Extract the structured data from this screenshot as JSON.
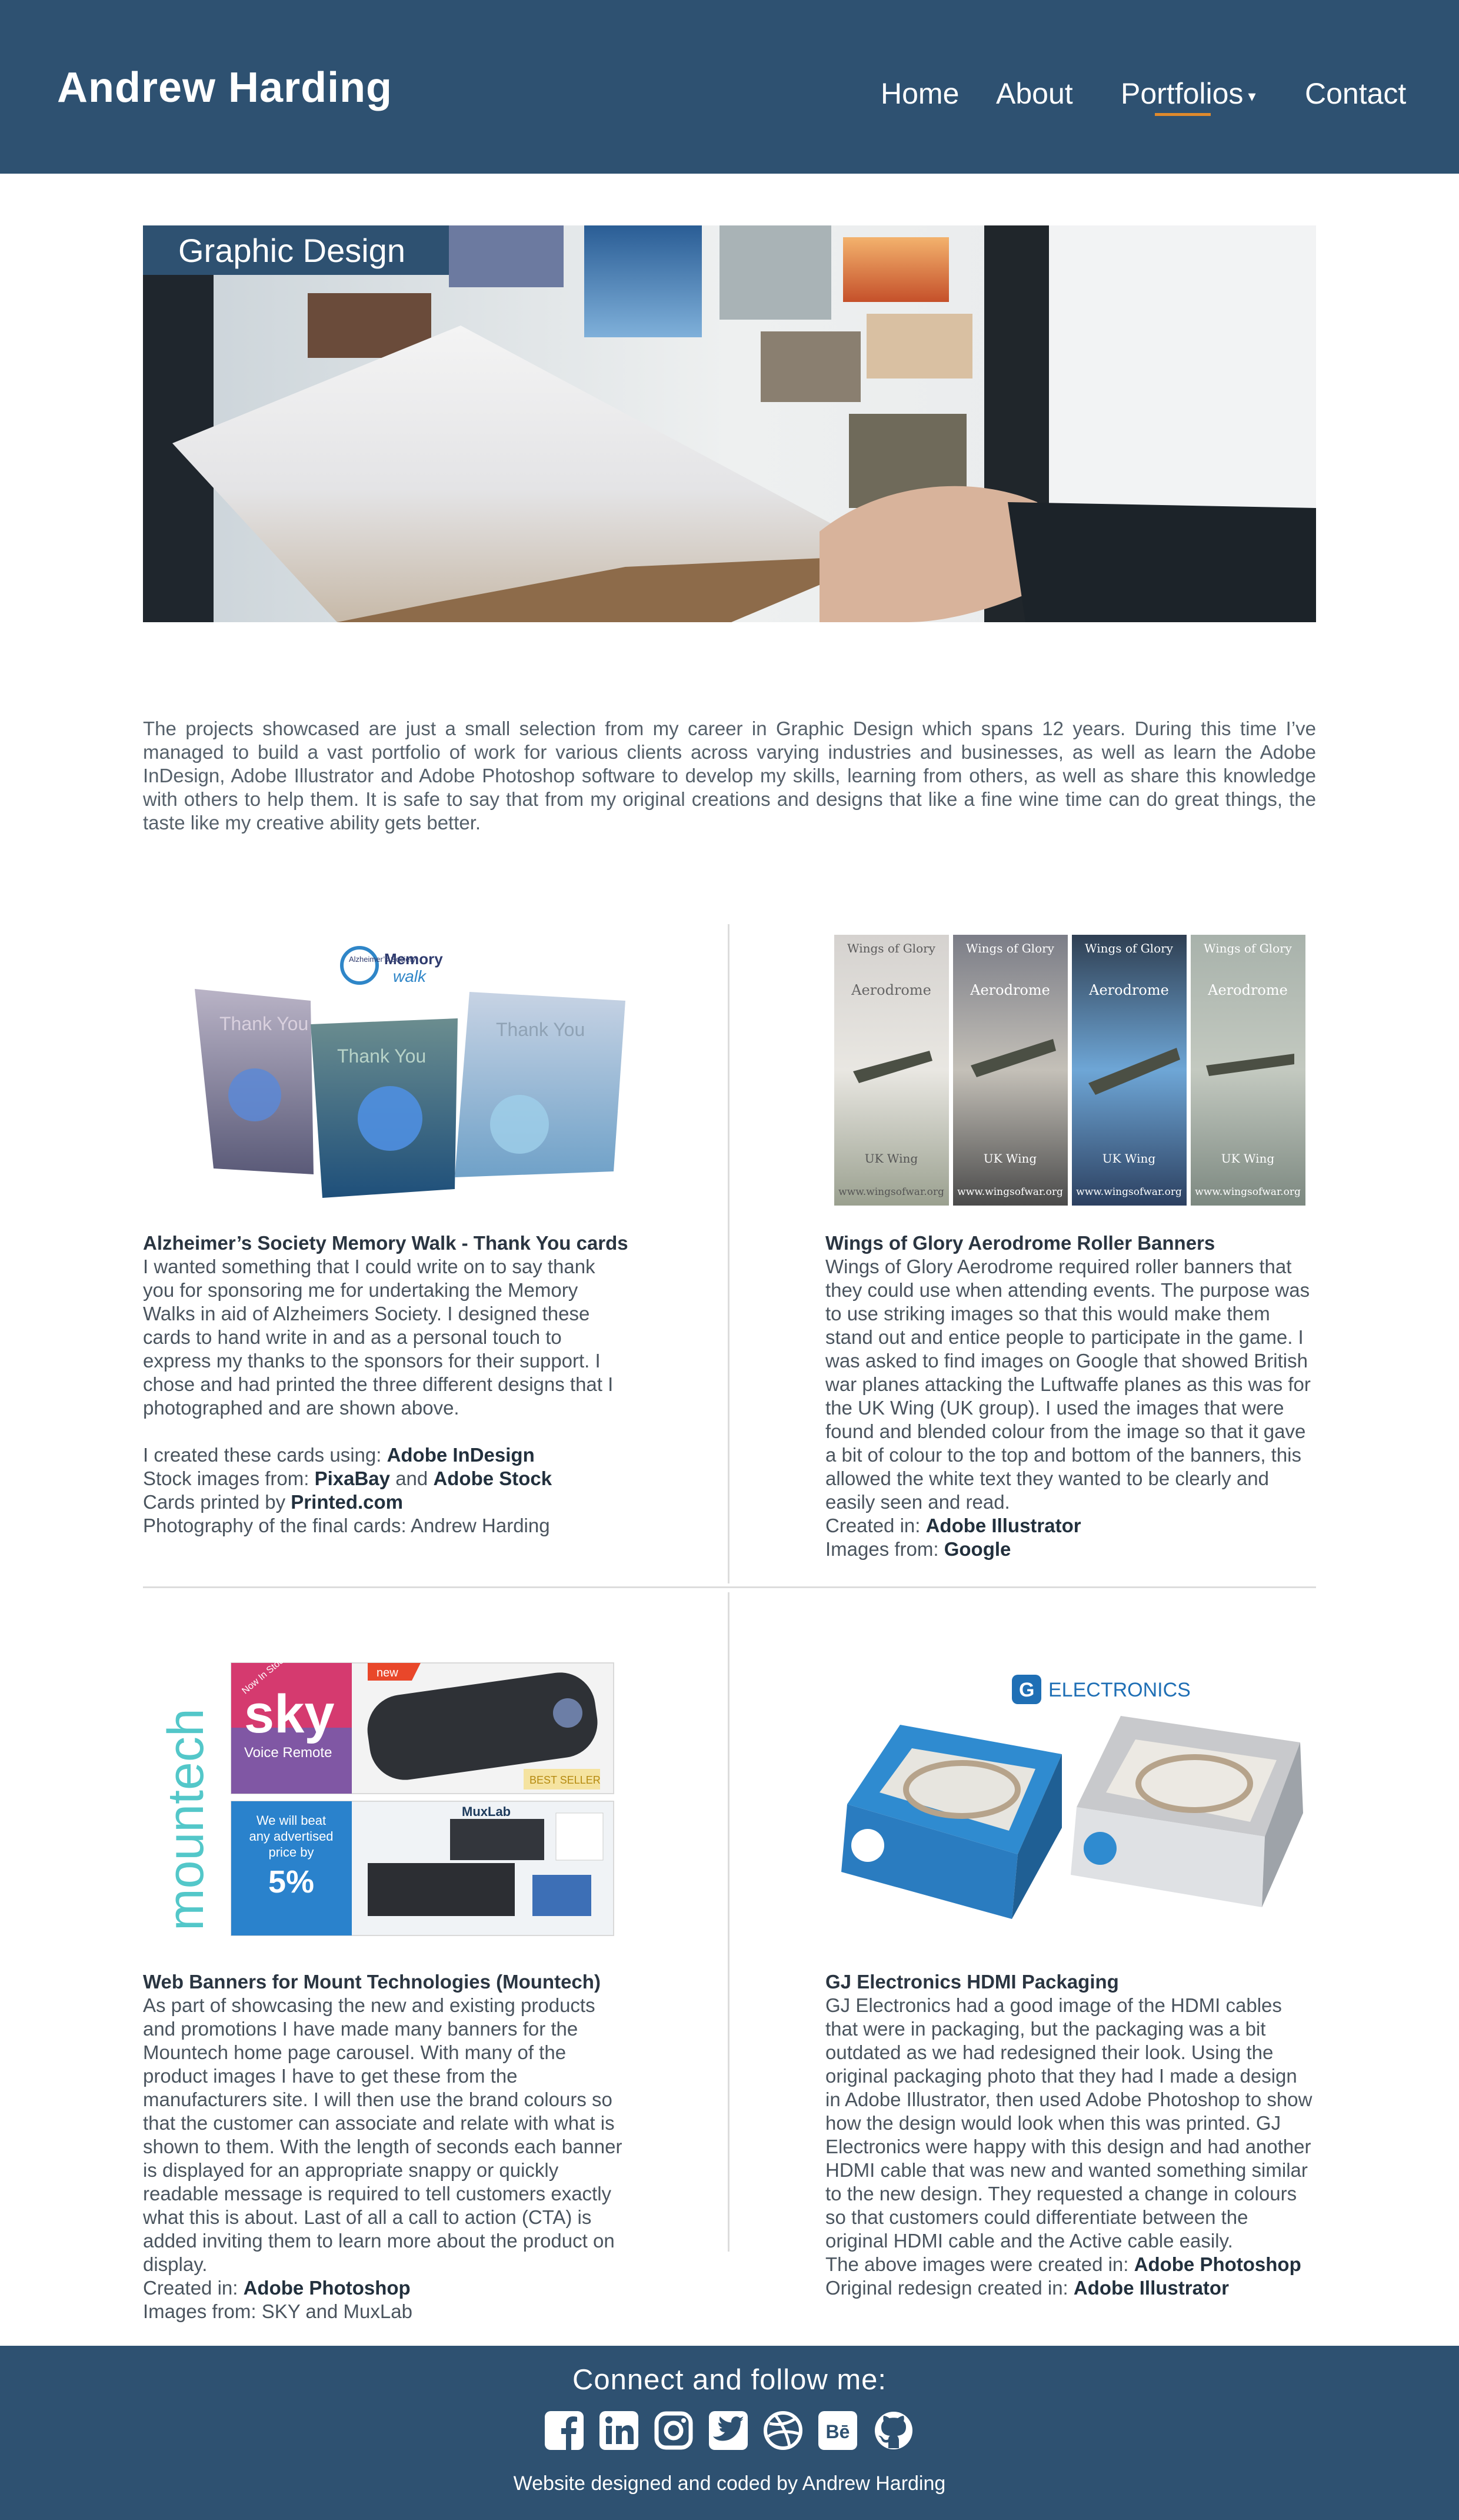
{
  "header": {
    "brand": "Andrew Harding",
    "nav": [
      {
        "label": "Home"
      },
      {
        "label": "About"
      },
      {
        "label": "Portfolios"
      },
      {
        "label": "Contact"
      }
    ],
    "caret": "▾"
  },
  "hero": {
    "badge": "Graphic Design"
  },
  "intro": "The projects showcased are just a small selection from my career in Graphic Design which spans 12 years. During this time I’ve managed to build a vast portfolio of work for various clients across varying industries and businesses, as well as learn the Adobe InDesign, Adobe Illustrator and Adobe Photoshop software to develop my skills, learning from others, as well as share this knowledge with others to help them. It is safe to say that from my original creations and designs that like a fine wine time can do great things, the taste like my creative ability gets better.",
  "projects": [
    {
      "title": "Alzheimer’s Society Memory Walk - Thank You cards",
      "description": "I wanted something that I could write on to say thank you for sponsoring me for undertaking the Memory Walks in aid of Alzheimers Society. I designed these cards to hand write in and as a personal touch to express my thanks to the sponsors for their support. I chose and had printed the three different designs that I photographed and are shown above.",
      "lines": [
        {
          "prefix": "I created these cards using: ",
          "bold": "Adobe InDesign"
        },
        {
          "prefix": "Stock images from: ",
          "bold": "PixaBay",
          "mid": " and ",
          "bold2": "Adobe Stock"
        },
        {
          "prefix": "Cards printed by ",
          "bold": "Printed.com"
        },
        {
          "prefix": "Photography of the final cards: Andrew Harding"
        }
      ],
      "image": {
        "card_text": "Thank You",
        "logo_line1": "Alzheimer’s Society",
        "logo_line2": "Memory",
        "logo_line3": "walk"
      }
    },
    {
      "title": "Wings of Glory Aerodrome Roller Banners",
      "description": "Wings of Glory Aerodrome required roller banners that they could use when attending events. The purpose was to use striking images so that this would make them stand out and entice people to participate in the game. I was asked to find images on Google that showed British war planes attacking the Luftwaffe planes as this was for the UK Wing (UK group). I used the images that were found and blended colour from the image so that it gave a bit of colour to the top and bottom of the banners, this allowed the white text they wanted to be clearly and easily seen and read.",
      "lines": [
        {
          "prefix": "Created in: ",
          "bold": "Adobe Illustrator"
        },
        {
          "prefix": "Images from: ",
          "bold": "Google"
        }
      ],
      "image": {
        "line1": "Wings of Glory",
        "line2": "Aerodrome",
        "line3": "UK Wing",
        "line4": "www.wingsofwar.org"
      }
    },
    {
      "title": "Web Banners for Mount Technologies (Mountech)",
      "description": "As part of showcasing the new and existing products and promotions I have made many banners for the Mountech home page carousel. With many of the product images I have to get these from the manufacturers site. I will then use the brand colours so that the customer can associate and relate with what is shown to them. With the length of seconds each banner is displayed for an appropriate snappy or quickly readable message is required to tell customers exactly what this is about. Last of all a call to action (CTA) is added inviting them to learn more about the product on display.",
      "lines": [
        {
          "prefix": "Created in: ",
          "bold": "Adobe Photoshop"
        },
        {
          "prefix": "Images from: SKY and MuxLab"
        }
      ],
      "image": {
        "brand": "mountech",
        "sky": "sky",
        "voice": "Voice Remote",
        "new_tag": "new",
        "in_stock": "Now In Stock",
        "best": "BEST SELLER",
        "beat1": "We will beat",
        "beat2": "any advertised",
        "beat3": "price by",
        "beat4": "5%",
        "muxlab": "MuxLab"
      }
    },
    {
      "title": "GJ Electronics HDMI Packaging",
      "description": "GJ Electronics had a good image of the HDMI cables that were in packaging, but the packaging was a bit outdated as we had redesigned their look. Using the original packaging photo that they had I made a design in Adobe Illustrator, then used Adobe Photoshop to show how the design would look when this was printed. GJ Electronics were happy with this design and had another HDMI cable that was new and wanted something similar to the new design. They requested a change in colours so that customers could differentiate between the original HDMI cable and the Active cable easily.",
      "lines": [
        {
          "prefix": "The above images were created in: ",
          "bold": "Adobe Photoshop"
        },
        {
          "prefix": "Original redesign created in: ",
          "bold": "Adobe Illustrator"
        }
      ],
      "image": {
        "logo": "ELECTRONICS",
        "mark": "G"
      }
    }
  ],
  "footer": {
    "connect": "Connect and follow me:",
    "socials": [
      "facebook-icon",
      "linkedin-icon",
      "instagram-icon",
      "twitter-icon",
      "dribbble-icon",
      "behance-icon",
      "github-icon"
    ],
    "behance_text": "Bē",
    "credit": "Website designed and coded by Andrew Harding"
  },
  "colors": {
    "header": "#2e5171",
    "accent": "#e08a2c",
    "text": "#4a545e"
  }
}
